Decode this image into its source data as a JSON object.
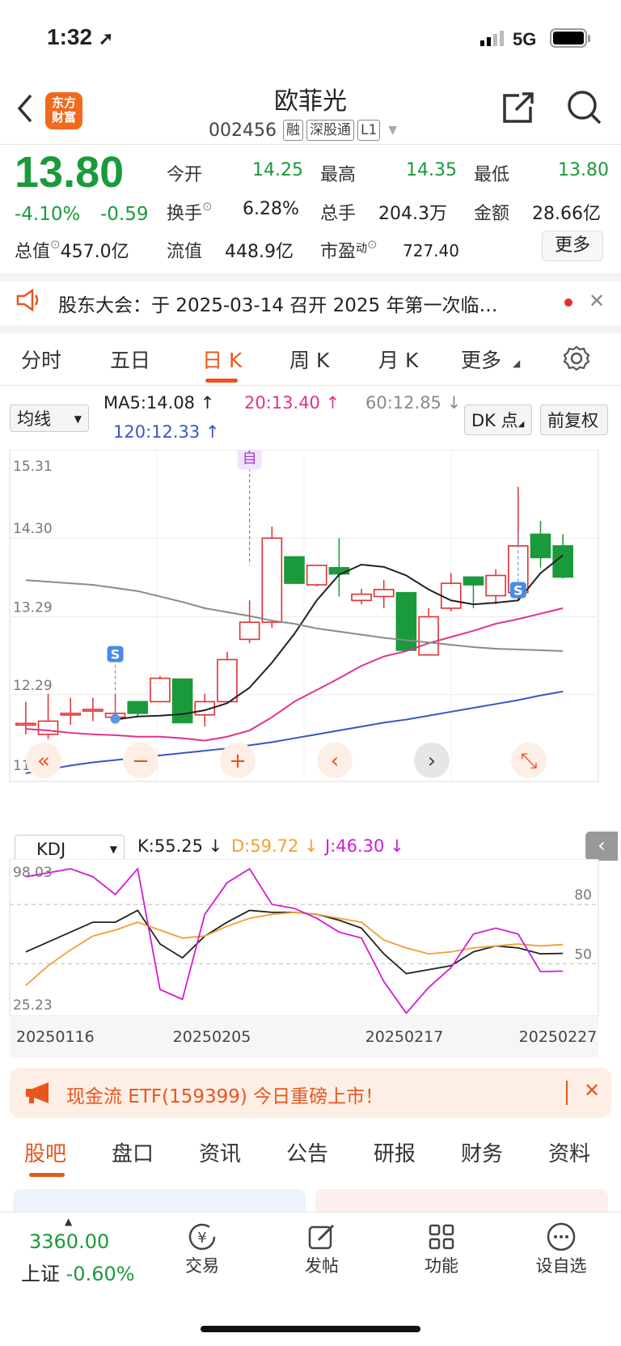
{
  "status_bar": {
    "time": "1:32",
    "network": "5G"
  },
  "header": {
    "title": "欧菲光",
    "code": "002456",
    "tags": [
      "融",
      "深股通",
      "L1"
    ],
    "logo_text_1": "东方",
    "logo_text_2": "财富"
  },
  "quote": {
    "price": "13.80",
    "change_pct": "-4.10%",
    "change": "-0.59",
    "open_label": "今开",
    "open": "14.25",
    "high_label": "最高",
    "high": "14.35",
    "low_label": "最低",
    "low": "13.80",
    "turnover_label": "换手",
    "turnover": "6.28%",
    "volume_label": "总手",
    "volume": "204.3万",
    "amount_label": "金额",
    "amount": "28.66亿",
    "mktcap_label": "总值",
    "mktcap": "457.0亿",
    "float_label": "流值",
    "float": "448.9亿",
    "pe_label": "市盈",
    "pe_sup": "动",
    "pe": "727.40",
    "more_button": "更多"
  },
  "notice": {
    "text": "股东大会：于 2025-03-14 召开 2025 年第一次临…"
  },
  "chart_tabs": {
    "items": [
      "分时",
      "五日",
      "日 K",
      "周 K",
      "月 K",
      "更多"
    ],
    "active": "日 K"
  },
  "indicator_bar": {
    "ma_select": "均线",
    "ma5": "MA5:14.08",
    "ma20": "20:13.40",
    "ma60": "60:12.85",
    "ma120": "120:12.33",
    "dk_button": "DK 点",
    "adjust_button": "前复权"
  },
  "kdj_bar": {
    "select": "KDJ",
    "k": "K:55.25",
    "d": "D:59.72",
    "j": "J:46.30"
  },
  "colors": {
    "up": "#e23030",
    "down": "#1a9a3a",
    "ma5": "#222222",
    "ma20": "#e0338f",
    "ma60": "#8a8a8a",
    "ma120": "#3b55c4",
    "accent": "#e8561b"
  },
  "chart_data": [
    {
      "type": "candlestick",
      "y_ticks": [
        "15.31",
        "14.30",
        "13.29",
        "12.29",
        "11.28"
      ],
      "x_ticks": [
        "20250116",
        "20250205",
        "20250217",
        "20250227"
      ],
      "ylim": [
        11.28,
        15.31
      ],
      "candles": [
        {
          "o": 11.92,
          "c": 11.92,
          "h": 12.2,
          "l": 11.78
        },
        {
          "o": 11.78,
          "c": 11.95,
          "h": 12.3,
          "l": 11.72
        },
        {
          "o": 12.05,
          "c": 12.05,
          "h": 12.25,
          "l": 11.9
        },
        {
          "o": 12.1,
          "c": 12.1,
          "h": 12.25,
          "l": 11.95
        },
        {
          "o": 12.0,
          "c": 12.05,
          "h": 12.3,
          "l": 11.95
        },
        {
          "o": 12.2,
          "c": 12.05,
          "h": 12.2,
          "l": 12.0
        },
        {
          "o": 12.2,
          "c": 12.5,
          "h": 12.53,
          "l": 12.2
        },
        {
          "o": 12.49,
          "c": 11.93,
          "h": 12.49,
          "l": 11.93
        },
        {
          "o": 12.03,
          "c": 12.2,
          "h": 12.3,
          "l": 11.88
        },
        {
          "o": 12.2,
          "c": 12.74,
          "h": 12.84,
          "l": 12.2
        },
        {
          "o": 13.0,
          "c": 13.22,
          "h": 13.5,
          "l": 12.95
        },
        {
          "o": 13.22,
          "c": 14.3,
          "h": 14.45,
          "l": 13.15
        },
        {
          "o": 14.06,
          "c": 13.72,
          "h": 14.06,
          "l": 13.72
        },
        {
          "o": 13.7,
          "c": 13.95,
          "h": 13.95,
          "l": 13.68
        },
        {
          "o": 13.92,
          "c": 13.84,
          "h": 14.3,
          "l": 13.55
        },
        {
          "o": 13.5,
          "c": 13.58,
          "h": 13.65,
          "l": 13.45
        },
        {
          "o": 13.55,
          "c": 13.64,
          "h": 13.76,
          "l": 13.4
        },
        {
          "o": 13.6,
          "c": 12.86,
          "h": 13.6,
          "l": 12.84
        },
        {
          "o": 12.8,
          "c": 13.29,
          "h": 13.4,
          "l": 12.8
        },
        {
          "o": 13.4,
          "c": 13.72,
          "h": 13.85,
          "l": 13.36
        },
        {
          "o": 13.8,
          "c": 13.7,
          "h": 13.8,
          "l": 13.4
        },
        {
          "o": 13.56,
          "c": 13.82,
          "h": 13.9,
          "l": 13.45
        },
        {
          "o": 13.6,
          "c": 14.2,
          "h": 14.96,
          "l": 13.5
        },
        {
          "o": 14.35,
          "c": 14.05,
          "h": 14.52,
          "l": 13.92
        },
        {
          "o": 14.2,
          "c": 13.8,
          "h": 14.35,
          "l": 13.78
        }
      ],
      "series": [
        {
          "name": "MA5",
          "values": [
            null,
            null,
            null,
            null,
            11.97,
            12.01,
            12.02,
            12.04,
            12.09,
            12.18,
            12.38,
            12.7,
            13.07,
            13.5,
            13.83,
            13.96,
            13.93,
            13.82,
            13.64,
            13.5,
            13.45,
            13.47,
            13.5,
            13.85,
            14.08
          ]
        },
        {
          "name": "20",
          "values": [
            11.85,
            11.83,
            11.8,
            11.78,
            11.77,
            11.75,
            11.75,
            11.73,
            11.7,
            11.75,
            11.83,
            12.0,
            12.2,
            12.35,
            12.5,
            12.66,
            12.78,
            12.85,
            12.95,
            13.03,
            13.11,
            13.2,
            13.26,
            13.33,
            13.4
          ]
        },
        {
          "name": "60",
          "values": [
            13.76,
            13.74,
            13.72,
            13.7,
            13.66,
            13.62,
            13.55,
            13.48,
            13.4,
            13.35,
            13.3,
            13.24,
            13.2,
            13.14,
            13.1,
            13.06,
            13.02,
            12.99,
            12.96,
            12.93,
            12.9,
            12.88,
            12.87,
            12.86,
            12.85
          ]
        },
        {
          "name": "120",
          "values": [
            11.28,
            11.33,
            11.38,
            11.42,
            11.45,
            11.48,
            11.51,
            11.54,
            11.57,
            11.6,
            11.64,
            11.68,
            11.73,
            11.78,
            11.83,
            11.88,
            11.93,
            11.97,
            12.02,
            12.07,
            12.12,
            12.17,
            12.22,
            12.28,
            12.33
          ]
        }
      ],
      "markers": [
        {
          "label": "S",
          "index": 4,
          "price": 11.98
        },
        {
          "label": "自",
          "index": 10,
          "price": 13.85
        },
        {
          "label": "S",
          "index": 22,
          "price": 14.36
        }
      ]
    },
    {
      "type": "line",
      "y_ticks": [
        "98.03",
        "25.23"
      ],
      "ylim": [
        25.23,
        98.03
      ],
      "ref_lines": [
        80,
        50
      ],
      "series": [
        {
          "name": "K",
          "values": [
            56,
            61,
            66,
            71,
            71,
            77,
            60,
            53,
            64,
            71,
            77,
            76,
            76,
            75,
            72,
            68,
            55,
            45,
            47,
            49,
            56,
            59,
            58,
            55,
            55.25
          ]
        },
        {
          "name": "D",
          "values": [
            39,
            49,
            57,
            64,
            67,
            71,
            67,
            63,
            64,
            69,
            73,
            75,
            76,
            75,
            73,
            71,
            62,
            58,
            55,
            56,
            58,
            59,
            60,
            59,
            59.72
          ]
        },
        {
          "name": "J",
          "values": [
            94,
            96,
            98,
            94,
            85,
            98,
            37,
            32,
            75,
            91,
            98,
            80,
            78,
            73,
            66,
            63,
            41,
            25,
            38,
            48,
            65,
            68,
            65,
            46,
            46.3
          ]
        }
      ]
    }
  ],
  "kline_buttons": [
    "«",
    "−",
    "+",
    "‹",
    "›",
    "⤡"
  ],
  "promo": {
    "text": "现金流 ETF(159399) 今日重磅上市！"
  },
  "bottom_tabs": {
    "items": [
      "股吧",
      "盘口",
      "资讯",
      "公告",
      "研报",
      "财务",
      "资料"
    ],
    "active": "股吧"
  },
  "bottom_nav": {
    "index_value": "3360.00",
    "index_name": "上证",
    "index_change": "-0.60%",
    "items": [
      {
        "label": "交易",
        "icon": "trade-icon"
      },
      {
        "label": "发帖",
        "icon": "compose-icon"
      },
      {
        "label": "功能",
        "icon": "grid-icon"
      },
      {
        "label": "设自选",
        "icon": "more-icon"
      }
    ]
  }
}
